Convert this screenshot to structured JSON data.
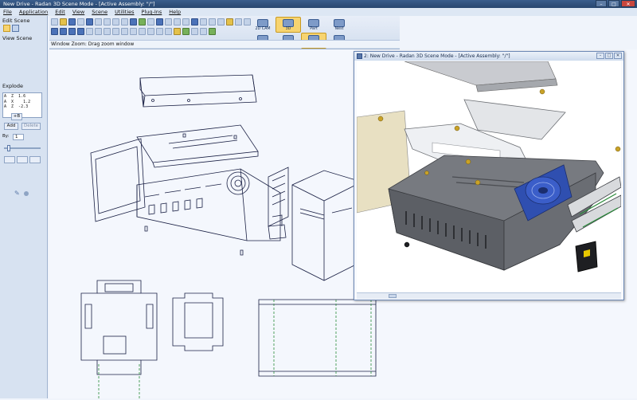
{
  "window": {
    "title": "New Drive - Radan 3D Scene Mode - [Active Assembly: \"/\"]",
    "minimize_glyph": "–",
    "maximize_glyph": "□",
    "close_glyph": "✕"
  },
  "menu": [
    "File",
    "Application",
    "Edit",
    "View",
    "Scene",
    "Utilities",
    "Plug-Ins",
    "Help"
  ],
  "left_panel": {
    "edit_scene_label": "Edit Scene",
    "view_scene_label": "View Scene",
    "explode_label": "Explode",
    "explode_text": "A  Z  1.6\nA  X    1.2\nA  Z  -2.3",
    "explode_btn": "+B",
    "add_label": "Add",
    "delete_label": "Delete",
    "by_label": "By:",
    "by_value": "1"
  },
  "toolbar": {
    "modes": [
      {
        "label": "2D CAM",
        "active": false
      },
      {
        "label": "3D",
        "active": true
      },
      {
        "label": "Part",
        "active": false
      },
      {
        "label": "Nest",
        "active": false
      },
      {
        "label": "Assembly",
        "active": false
      },
      {
        "label": "Modelling",
        "active": false
      },
      {
        "label": "Scene",
        "active": true
      },
      {
        "label": "Radbend/CNC",
        "active": false
      }
    ]
  },
  "status": {
    "text": "Window Zoom: Drag zoom window"
  },
  "subwindow": {
    "title": "2: New Drive - Radan 3D Scene Mode - [Active Assembly: \"/\"]",
    "minimize_glyph": "–",
    "maximize_glyph": "□",
    "close_glyph": "✕"
  },
  "colors": {
    "wire": "#1a2044",
    "wire_green": "#2a8a3a",
    "shaded_grey": "#7a7d82",
    "shaded_dark": "#4d5055",
    "fan_blue": "#2f4fb0",
    "highlight": "#f7d470"
  }
}
